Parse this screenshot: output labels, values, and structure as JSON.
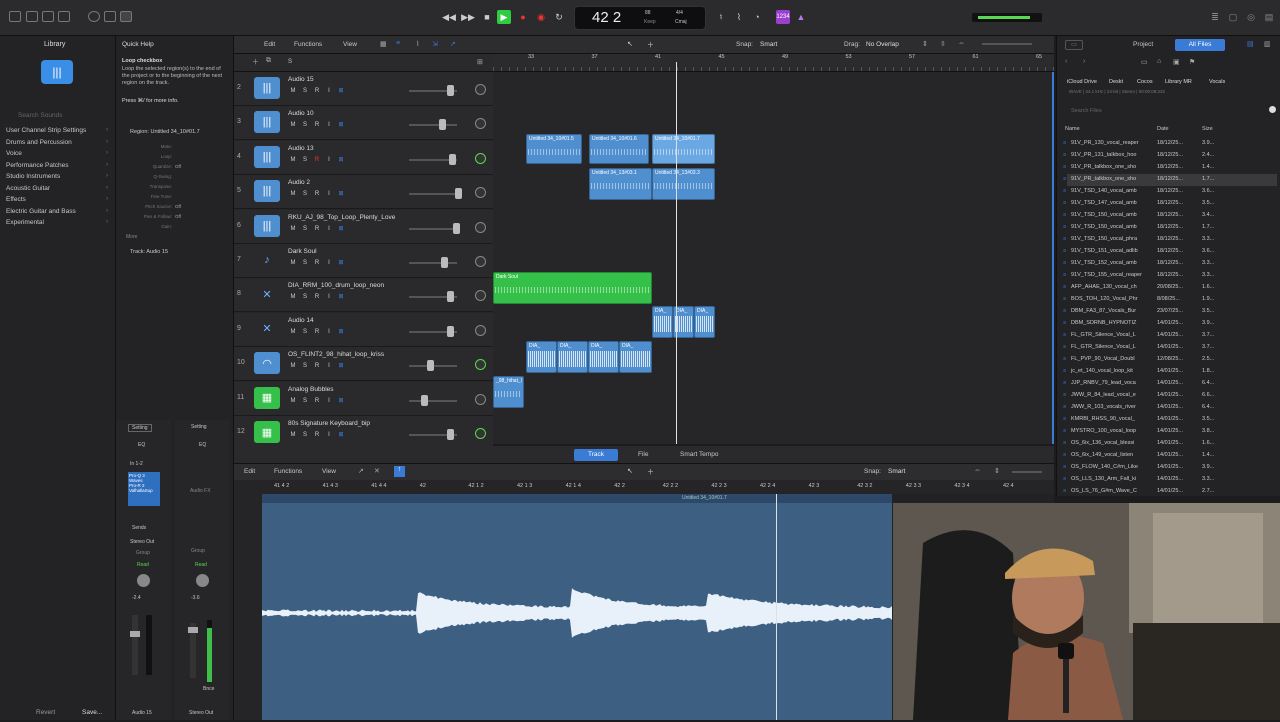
{
  "topbar": {
    "lcd_position": "42 2",
    "lcd_bpm": "88",
    "lcd_keep": "Keep",
    "lcd_sig": "4/4",
    "lcd_key": "Cmaj"
  },
  "library": {
    "title": "Library",
    "search_placeholder": "Search Sounds",
    "items": [
      {
        "label": "User Channel Strip Settings"
      },
      {
        "label": "Drums and Percussion"
      },
      {
        "label": "Voice"
      },
      {
        "label": "Performance Patches"
      },
      {
        "label": "Studio Instruments"
      },
      {
        "label": "Acoustic Guitar"
      },
      {
        "label": "Effects"
      },
      {
        "label": "Electric Guitar and Bass"
      },
      {
        "label": "Experimental"
      }
    ],
    "revert_label": "Revert",
    "save_label": "Save..."
  },
  "quickhelp": {
    "title": "Quick Help",
    "heading": "Loop checkbox",
    "body": "Loop the selected region(s) to the end of the project or to the beginning of the next region on the track.",
    "hint": "Press ⌘/ for more info.",
    "region_label": "Region: Untitled 34_10#01.7",
    "params": [
      {
        "label": "Mute:",
        "value": ""
      },
      {
        "label": "Loop:",
        "value": ""
      },
      {
        "label": "Quantize:",
        "value": "Off"
      },
      {
        "label": "Q-Swing:",
        "value": ""
      },
      {
        "label": "Transpose:",
        "value": ""
      },
      {
        "label": "Fine Tune:",
        "value": ""
      },
      {
        "label": "Pitch Source:",
        "value": "Off"
      },
      {
        "label": "Flex & Follow:",
        "value": "Off"
      },
      {
        "label": "Gain:",
        "value": ""
      }
    ],
    "more": "More",
    "track_label": "Track: Audio 15"
  },
  "strips": {
    "left": {
      "setting": "Setting",
      "eq": "EQ",
      "input": "In 1-2",
      "plugins": [
        "Pro-Q 3",
        "Waves",
        "Pro-R 2",
        "ValhallaSup"
      ],
      "sends": "Sends",
      "output": "Stereo Out",
      "group": "Group",
      "read": "Read",
      "volume": "-2.4",
      "name": "Audio 15"
    },
    "right": {
      "setting": "Setting",
      "eq": "EQ",
      "audio_fx": "Audio FX",
      "bounce": "Bnce",
      "output": "",
      "group": "Group",
      "read": "Read",
      "volume": "-3.6",
      "name": "Stereo Out"
    }
  },
  "tracks_toolbar": {
    "edit": "Edit",
    "functions": "Functions",
    "view": "View",
    "snap_label": "Snap:",
    "snap_value": "Smart",
    "drag_label": "Drag:",
    "drag_value": "No Overlap"
  },
  "ruler_bars": [
    "33",
    "37",
    "41",
    "45",
    "49",
    "53",
    "57",
    "61",
    "65"
  ],
  "tracks": [
    {
      "num": "2",
      "name": "Audio 15",
      "type": "audio"
    },
    {
      "num": "3",
      "name": "Audio 10",
      "type": "audio"
    },
    {
      "num": "4",
      "name": "Audio 13",
      "type": "audio"
    },
    {
      "num": "5",
      "name": "Audio 2",
      "type": "audio"
    },
    {
      "num": "6",
      "name": "RKU_AJ_98_Top_Loop_Plenty_Love",
      "type": "audio"
    },
    {
      "num": "7",
      "name": "Dark Soul",
      "type": "instrument-guitar"
    },
    {
      "num": "8",
      "name": "DIA_RRM_100_drum_loop_neon",
      "type": "drums"
    },
    {
      "num": "9",
      "name": "Audio 14",
      "type": "drums"
    },
    {
      "num": "10",
      "name": "OS_FLINT2_98_hihat_loop_kriss",
      "type": "hihat"
    },
    {
      "num": "11",
      "name": "Analog Bubbles",
      "type": "synth"
    },
    {
      "num": "12",
      "name": "80s Signature Keyboard_bip",
      "type": "synth"
    }
  ],
  "regions": [
    {
      "label": "Untitled 34_10#01.5"
    },
    {
      "label": "Untitled 34_10#01.6"
    },
    {
      "label": "Untitled 34_10#01.7"
    },
    {
      "label": "Untitled 34_13#03.1"
    },
    {
      "label": "Untitled 34_13#03.3"
    },
    {
      "label": "Dark Soul"
    },
    {
      "label": "DIA_"
    },
    {
      "label": "DIA_"
    },
    {
      "label": "DIA_"
    },
    {
      "label": "DIA_"
    },
    {
      "label": "DIA_"
    },
    {
      "label": "DIA_"
    },
    {
      "label": "DIA_"
    },
    {
      "label": "_98_hihat_l"
    }
  ],
  "editor": {
    "tabs": [
      "Track",
      "File",
      "Smart Tempo"
    ],
    "edit": "Edit",
    "functions": "Functions",
    "view": "View",
    "snap_label": "Snap:",
    "snap_value": "Smart",
    "ruler": [
      "41 4 2",
      "41 4 3",
      "41 4 4",
      "42",
      "42 1 2",
      "42 1 3",
      "42 1 4",
      "42 2",
      "42 2 2",
      "42 2 3",
      "42 2 4",
      "42 3",
      "42 3 2",
      "42 3 3",
      "42 3 4",
      "42 4"
    ],
    "region_title": "Untitled 34_10#01.7"
  },
  "browser": {
    "tabs": [
      "Project",
      "All Files"
    ],
    "path": [
      "iCloud Drive",
      "Deskt",
      "Cocos",
      "Library MR",
      "Vocals"
    ],
    "info": "WAVE | 44.1 kHz | 24-bit | Stereo | 00:00:08:232",
    "search_placeholder": "Search Files",
    "columns": [
      "Name",
      "Date",
      "Size"
    ],
    "files": [
      {
        "name": "91V_PR_130_vocal_reaper",
        "date": "18/12/25...",
        "size": "3.9..."
      },
      {
        "name": "91V_PR_131_talkbox_hoo",
        "date": "18/12/25...",
        "size": "2.4..."
      },
      {
        "name": "91V_PR_talkbox_one_sho",
        "date": "18/12/25...",
        "size": "1.4..."
      },
      {
        "name": "91V_PR_talkbox_one_sho",
        "date": "18/12/25...",
        "size": "1.7..."
      },
      {
        "name": "91V_TSD_140_vocal_amb",
        "date": "18/12/25...",
        "size": "3.6..."
      },
      {
        "name": "91V_TSD_147_vocal_amb",
        "date": "18/12/25...",
        "size": "3.5..."
      },
      {
        "name": "91V_TSD_150_vocal_amb",
        "date": "18/12/25...",
        "size": "3.4..."
      },
      {
        "name": "91V_TSD_150_vocal_amb",
        "date": "18/12/25...",
        "size": "1.7..."
      },
      {
        "name": "91V_TSD_150_vocal_phra",
        "date": "18/12/25...",
        "size": "3.3..."
      },
      {
        "name": "91V_TSD_151_vocal_adlib",
        "date": "18/12/25...",
        "size": "3.6..."
      },
      {
        "name": "91V_TSD_152_vocal_amb",
        "date": "18/12/25...",
        "size": "3.3..."
      },
      {
        "name": "91V_TSD_155_vocal_reaper",
        "date": "18/12/25...",
        "size": "3.3..."
      },
      {
        "name": "AFP_AHAE_130_vocal_ch",
        "date": "20/08/25...",
        "size": "1.6..."
      },
      {
        "name": "BOS_TOH_120_Vocal_Phr",
        "date": "8/08/25...",
        "size": "1.9..."
      },
      {
        "name": "DBM_FA3_87_Vocals_Bur",
        "date": "23/07/25...",
        "size": "3.5..."
      },
      {
        "name": "DBM_SDRNB_HYPNOTIZ",
        "date": "14/01/25...",
        "size": "3.9..."
      },
      {
        "name": "FL_GTR_Silence_Vocal_L",
        "date": "14/01/25...",
        "size": "3.7..."
      },
      {
        "name": "FL_GTR_Silence_Vocal_L",
        "date": "14/01/25...",
        "size": "3.7..."
      },
      {
        "name": "FL_PVP_90_Vocal_Doubl",
        "date": "12/08/25...",
        "size": "2.5..."
      },
      {
        "name": "jc_et_140_vocal_loop_kit",
        "date": "14/01/25...",
        "size": "1.8..."
      },
      {
        "name": "JJP_RNBV_79_lead_voca",
        "date": "14/01/25...",
        "size": "6.4..."
      },
      {
        "name": "JWW_R_84_lead_vocal_e",
        "date": "14/01/25...",
        "size": "6.6..."
      },
      {
        "name": "JWW_R_103_vocals_river",
        "date": "14/01/25...",
        "size": "6.4..."
      },
      {
        "name": "KMRBI_RHSS_90_vocal_",
        "date": "14/01/25...",
        "size": "3.5..."
      },
      {
        "name": "MYSTRO_100_vocal_loop",
        "date": "14/01/25...",
        "size": "3.8..."
      },
      {
        "name": "OS_6ix_136_vocal_blessi",
        "date": "14/01/25...",
        "size": "1.6..."
      },
      {
        "name": "OS_6ix_149_vocal_listen",
        "date": "14/01/25...",
        "size": "1.4..."
      },
      {
        "name": "OS_FLOW_140_C#m_Like",
        "date": "14/01/25...",
        "size": "3.9..."
      },
      {
        "name": "OS_LLS_130_Arm_Fall_ki",
        "date": "14/01/25...",
        "size": "3.3..."
      },
      {
        "name": "OS_LS_76_G#m_Wave_C",
        "date": "14/01/25...",
        "size": "2.7..."
      }
    ]
  },
  "colors": {
    "region_blue": "#4f8fd0",
    "region_green": "#35c04a",
    "accent": "#3a7bd5",
    "waveform_bg": "#3d5f82"
  }
}
